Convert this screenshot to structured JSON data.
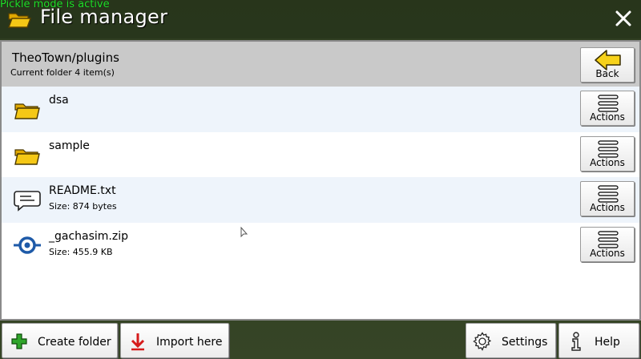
{
  "status": {
    "pickle_mode": "Pickle mode is active"
  },
  "window": {
    "title": "File manager",
    "close_icon": "close-icon",
    "title_icon": "folder-open-icon"
  },
  "header": {
    "path": "TheoTown/plugins",
    "item_count": "Current folder 4 item(s)",
    "back_label": "Back"
  },
  "files": [
    {
      "name": "dsa",
      "size": "",
      "icon": "folder-icon"
    },
    {
      "name": "sample",
      "size": "",
      "icon": "folder-icon"
    },
    {
      "name": "README.txt",
      "size": "Size: 874 bytes",
      "icon": "text-file-icon"
    },
    {
      "name": "_gachasim.zip",
      "size": "Size: 455.9 KB",
      "icon": "plugin-zip-icon"
    }
  ],
  "row_action_label": "Actions",
  "footer": {
    "create_folder": "Create folder",
    "import_here": "Import here",
    "settings": "Settings",
    "help": "Help"
  },
  "colors": {
    "header_bg": "#c9c9c9",
    "alt_row_bg": "#eef4fb",
    "folder": "#f5c816",
    "back_arrow": "#f7d21a",
    "plus": "#2fa52a",
    "import_arrow": "#d61b1b",
    "pickle_text": "#22e22b"
  }
}
